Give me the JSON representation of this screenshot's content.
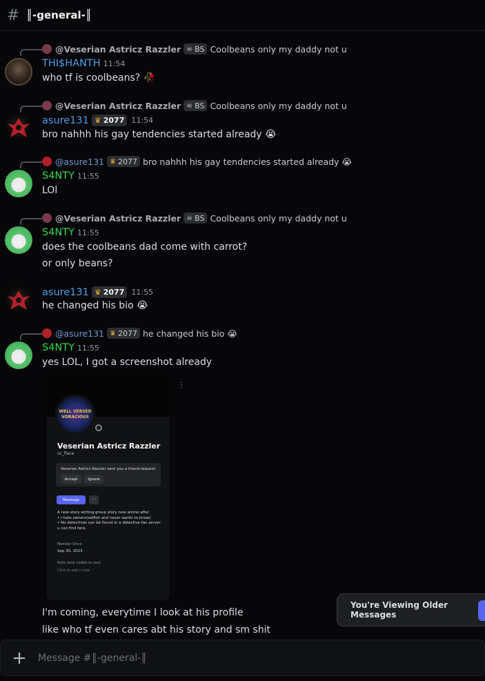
{
  "channel": {
    "title": "║-general-║"
  },
  "composer": {
    "placeholder": "Message #║-general-║"
  },
  "older_messages": {
    "label": "You're Viewing Older Messages"
  },
  "colors": {
    "accent": "#5865f2",
    "author_blue": "#4d9ee8",
    "author_green": "#2fd94b"
  },
  "messages": [
    {
      "reply": {
        "name": "@Veserian Astricz Razzler",
        "tag": "BS",
        "text": "Coolbeans only my daddy not u"
      },
      "author": "THI$HANTH",
      "time": "11:54",
      "lines": [
        "who tf is coolbeans? 🥀"
      ]
    },
    {
      "reply": {
        "name": "@Veserian Astricz Razzler",
        "tag": "BS",
        "text": "Coolbeans only my daddy not u"
      },
      "author": "asure131",
      "author_tag": "2077",
      "time": "11:54",
      "lines": [
        "bro nahhh his gay tendencies started already 😭"
      ]
    },
    {
      "reply": {
        "name": "@asure131",
        "tag": "2077",
        "text": "bro nahhh his gay tendencies started already 😭"
      },
      "author": "S4NTY",
      "time": "11:55",
      "lines": [
        "LOl"
      ]
    },
    {
      "reply": {
        "name": "@Veserian Astricz Razzler",
        "tag": "BS",
        "text": "Coolbeans only my daddy not u"
      },
      "author": "S4NTY",
      "time": "11:55",
      "lines": [
        "does the coolbeans dad come with carrot?",
        "or only beans?"
      ]
    },
    {
      "author": "asure131",
      "author_tag": "2077",
      "time": "11:55",
      "lines": [
        "he changed his bio 😭"
      ]
    },
    {
      "reply": {
        "name": "@asure131",
        "tag": "2077",
        "text": "he changed his bio 😭"
      },
      "author": "S4NTY",
      "time": "11:55",
      "lines": [
        "yes LOL, I got a screenshot already"
      ],
      "after_lines": [
        "I'm coming, everytime I look at his profile",
        "like who tf even cares abt his story and sm shit"
      ]
    }
  ],
  "attachment": {
    "avatar_text": "WELL VERSED VORACIOUS",
    "name": "Veserian Astricz Razzler",
    "username": "vc_flace",
    "request_text": "Veserian Astricz Razzler sent you a friend request.",
    "accept": "Accept",
    "ignore": "Ignore",
    "message_btn": "Message",
    "more_btn": "···",
    "bio": [
      "A new story writing group story now anime after",
      "•  I hate owners(selfish and never wants to know)",
      "•  No detectives can be found in a detective fan server",
      "u can find fans"
    ],
    "member_since_label": "Member Since",
    "member_since": "Sep 30, 2023",
    "note_label": "Note (only visible to you)",
    "note_placeholder": "Click to add a note"
  }
}
